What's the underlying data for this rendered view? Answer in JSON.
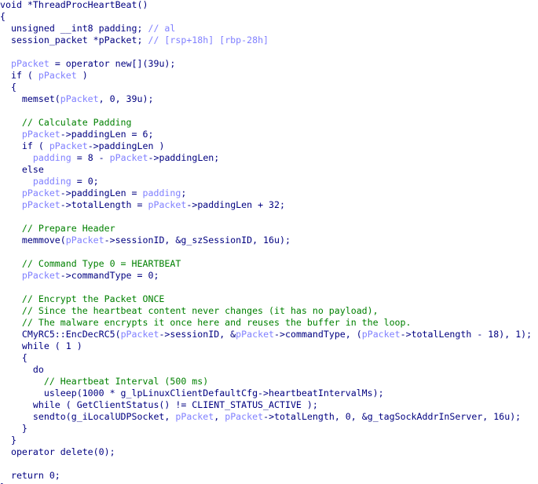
{
  "colors": {
    "code": "#000080",
    "local_variable": "#8080ff",
    "comment": "#008000",
    "background": "#ffffff"
  },
  "lines": [
    [
      {
        "t": "void *ThreadProcHeartBeat()",
        "k": "code"
      }
    ],
    [
      {
        "t": "{",
        "k": "code"
      }
    ],
    [
      {
        "t": "  unsigned __int8 padding; ",
        "k": "code"
      },
      {
        "t": "// al",
        "k": "var"
      }
    ],
    [
      {
        "t": "  session_packet *pPacket; ",
        "k": "code"
      },
      {
        "t": "// [rsp+18h] [rbp-28h]",
        "k": "var"
      }
    ],
    [],
    [
      {
        "t": "  ",
        "k": "code"
      },
      {
        "t": "pPacket",
        "k": "var"
      },
      {
        "t": " = operator new[](39u);",
        "k": "code"
      }
    ],
    [
      {
        "t": "  if ( ",
        "k": "code"
      },
      {
        "t": "pPacket",
        "k": "var"
      },
      {
        "t": " )",
        "k": "code"
      }
    ],
    [
      {
        "t": "  {",
        "k": "code"
      }
    ],
    [
      {
        "t": "    memset(",
        "k": "code"
      },
      {
        "t": "pPacket",
        "k": "var"
      },
      {
        "t": ", 0, 39u);",
        "k": "code"
      }
    ],
    [],
    [
      {
        "t": "    // Calculate Padding",
        "k": "comment"
      }
    ],
    [
      {
        "t": "    ",
        "k": "code"
      },
      {
        "t": "pPacket",
        "k": "var"
      },
      {
        "t": "->paddingLen = 6;",
        "k": "code"
      }
    ],
    [
      {
        "t": "    if ( ",
        "k": "code"
      },
      {
        "t": "pPacket",
        "k": "var"
      },
      {
        "t": "->paddingLen )",
        "k": "code"
      }
    ],
    [
      {
        "t": "      ",
        "k": "code"
      },
      {
        "t": "padding",
        "k": "var"
      },
      {
        "t": " = 8 - ",
        "k": "code"
      },
      {
        "t": "pPacket",
        "k": "var"
      },
      {
        "t": "->paddingLen;",
        "k": "code"
      }
    ],
    [
      {
        "t": "    else",
        "k": "code"
      }
    ],
    [
      {
        "t": "      ",
        "k": "code"
      },
      {
        "t": "padding",
        "k": "var"
      },
      {
        "t": " = 0;",
        "k": "code"
      }
    ],
    [
      {
        "t": "    ",
        "k": "code"
      },
      {
        "t": "pPacket",
        "k": "var"
      },
      {
        "t": "->paddingLen = ",
        "k": "code"
      },
      {
        "t": "padding",
        "k": "var"
      },
      {
        "t": ";",
        "k": "code"
      }
    ],
    [
      {
        "t": "    ",
        "k": "code"
      },
      {
        "t": "pPacket",
        "k": "var"
      },
      {
        "t": "->totalLength = ",
        "k": "code"
      },
      {
        "t": "pPacket",
        "k": "var"
      },
      {
        "t": "->paddingLen + 32;",
        "k": "code"
      }
    ],
    [],
    [
      {
        "t": "    // Prepare Header",
        "k": "comment"
      }
    ],
    [
      {
        "t": "    memmove(",
        "k": "code"
      },
      {
        "t": "pPacket",
        "k": "var"
      },
      {
        "t": "->sessionID, &g_szSessionID, 16u);",
        "k": "code"
      }
    ],
    [],
    [
      {
        "t": "    // Command Type 0 = HEARTBEAT",
        "k": "comment"
      }
    ],
    [
      {
        "t": "    ",
        "k": "code"
      },
      {
        "t": "pPacket",
        "k": "var"
      },
      {
        "t": "->commandType = 0;",
        "k": "code"
      }
    ],
    [],
    [
      {
        "t": "    // Encrypt the Packet ONCE",
        "k": "comment"
      }
    ],
    [
      {
        "t": "    // Since the heartbeat content never changes (it has no payload),",
        "k": "comment"
      }
    ],
    [
      {
        "t": "    // The malware encrypts it once here and reuses the buffer in the loop.",
        "k": "comment"
      }
    ],
    [
      {
        "t": "    CMyRC5::EncDecRC5(",
        "k": "code"
      },
      {
        "t": "pPacket",
        "k": "var"
      },
      {
        "t": "->sessionID, &",
        "k": "code"
      },
      {
        "t": "pPacket",
        "k": "var"
      },
      {
        "t": "->commandType, (",
        "k": "code"
      },
      {
        "t": "pPacket",
        "k": "var"
      },
      {
        "t": "->totalLength - 18), 1);",
        "k": "code"
      }
    ],
    [
      {
        "t": "    while ( 1 )",
        "k": "code"
      }
    ],
    [
      {
        "t": "    {",
        "k": "code"
      }
    ],
    [
      {
        "t": "      do",
        "k": "code"
      }
    ],
    [
      {
        "t": "        // Heartbeat Interval (500 ms)",
        "k": "comment"
      }
    ],
    [
      {
        "t": "        usleep(1000 * g_lpLinuxClientDefaultCfg->heartbeatIntervalMs);",
        "k": "code"
      }
    ],
    [
      {
        "t": "      while ( GetClientStatus() != CLIENT_STATUS_ACTIVE );",
        "k": "code"
      }
    ],
    [
      {
        "t": "      sendto(g_iLocalUDPSocket, ",
        "k": "code"
      },
      {
        "t": "pPacket",
        "k": "var"
      },
      {
        "t": ", ",
        "k": "code"
      },
      {
        "t": "pPacket",
        "k": "var"
      },
      {
        "t": "->totalLength, 0, &g_tagSockAddrInServer, 16u);",
        "k": "code"
      }
    ],
    [
      {
        "t": "    }",
        "k": "code"
      }
    ],
    [
      {
        "t": "  }",
        "k": "code"
      }
    ],
    [
      {
        "t": "  operator delete(0);",
        "k": "code"
      }
    ],
    [],
    [
      {
        "t": "  return 0;",
        "k": "code"
      }
    ],
    [
      {
        "t": "}",
        "k": "code"
      }
    ]
  ]
}
